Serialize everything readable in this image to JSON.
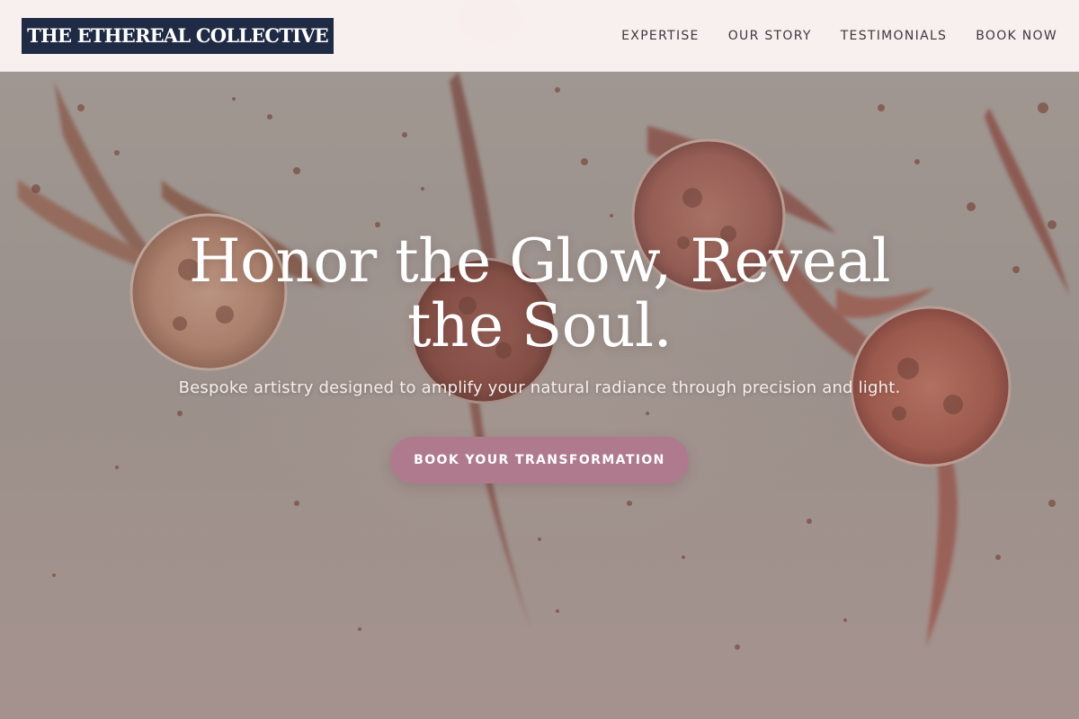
{
  "header": {
    "logo_text": "THE ETHEREAL COLLECTIVE",
    "nav": [
      {
        "label": "EXPERTISE"
      },
      {
        "label": "OUR STORY"
      },
      {
        "label": "TESTIMONIALS"
      },
      {
        "label": "BOOK NOW"
      }
    ]
  },
  "hero": {
    "title": "Honor the Glow, Reveal the Soul.",
    "subtitle": "Bespoke artistry designed to amplify your natural radiance through precision and light.",
    "cta_label": "BOOK YOUR TRANSFORMATION",
    "background_image": "crushed-makeup-powder-swatches"
  },
  "colors": {
    "header_bg": "#fcf3f2",
    "logo_bg": "#1f2a44",
    "nav_text": "#3a3a42",
    "cta_bg": "#b07a8e",
    "hero_text": "#ffffff"
  }
}
